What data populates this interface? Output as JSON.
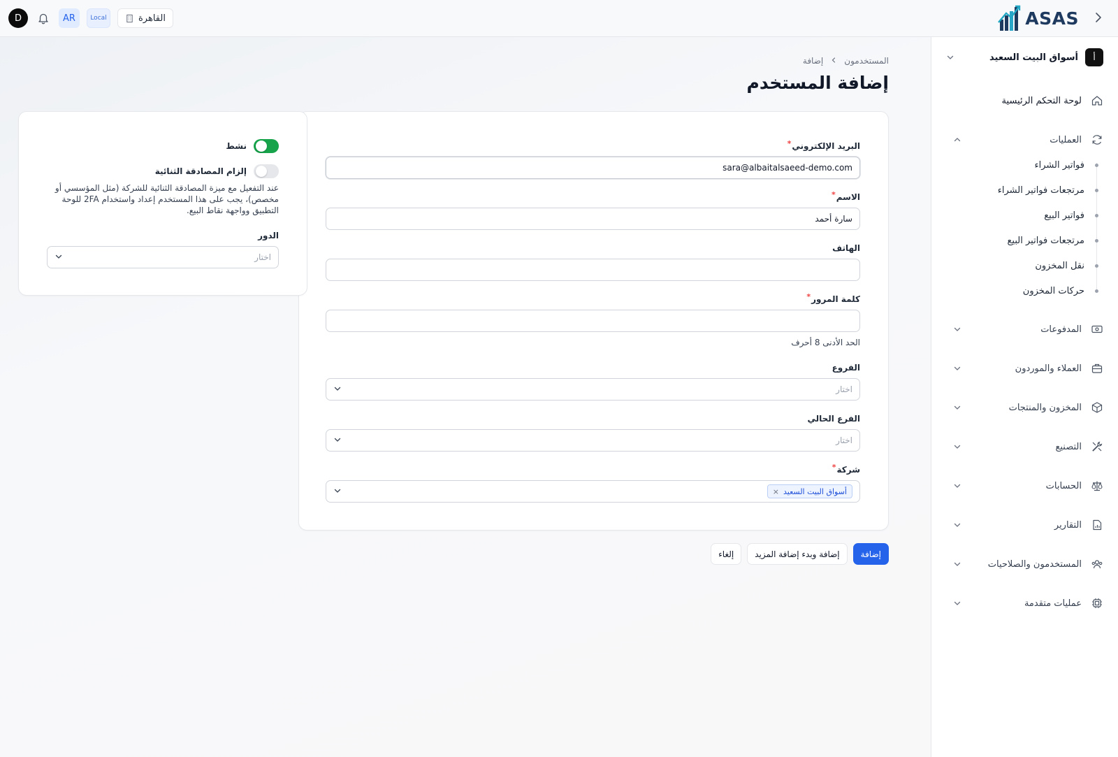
{
  "topbar": {
    "logo_text": "ASAS",
    "avatar_letter": "D",
    "language": "AR",
    "env_badge": "Local",
    "branch": "القاهرة"
  },
  "sidebar": {
    "company_badge": "أ",
    "company_name": "أسواق البيت السعيد",
    "dashboard": "لوحة التحكم الرئيسية",
    "operations": {
      "label": "العمليات",
      "children": [
        "فواتير الشراء",
        "مرتجعات فواتير الشراء",
        "فواتير البيع",
        "مرتجعات فواتير البيع",
        "نقل المخزون",
        "حركات المخزون"
      ]
    },
    "sections": [
      "المدفوعات",
      "العملاء والموردون",
      "المخزون والمنتجات",
      "التصنيع",
      "الحسابات",
      "التقارير",
      "المستخدمون والصلاحيات",
      "عمليات متقدمة"
    ]
  },
  "breadcrumb": {
    "parent": "المستخدمون",
    "current": "إضافة"
  },
  "page": {
    "title": "إضافة المستخدم"
  },
  "form": {
    "email": {
      "label": "البريد الإلكتروني",
      "required": "*",
      "value": "sara@albaitalsaeed-demo.com"
    },
    "name": {
      "label": "الاسم",
      "required": "*",
      "value": "سارة أحمد"
    },
    "phone": {
      "label": "الهاتف",
      "value": ""
    },
    "password": {
      "label": "كلمة المرور",
      "required": "*",
      "value": "",
      "hint": "الحد الأدنى 8 أحرف"
    },
    "branches": {
      "label": "الفروع",
      "placeholder": "اختار"
    },
    "current_branch": {
      "label": "الفرع الحالي",
      "placeholder": "اختار"
    },
    "company": {
      "label": "شركة",
      "required": "*",
      "tag": "أسواق البيت السعيد",
      "tag_remove": "×"
    }
  },
  "side": {
    "active": {
      "label": "نشط",
      "on": true
    },
    "twofa": {
      "label": "إلزام المصادقة الثنائية",
      "on": false,
      "description": "عند التفعيل مع ميزة المصادقة الثنائية للشركة (مثل المؤسسي أو مخصص)، يجب على هذا المستخدم إعداد واستخدام 2FA للوحة التطبيق وواجهة نقاط البيع."
    },
    "role": {
      "label": "الدور",
      "placeholder": "اختار"
    }
  },
  "actions": {
    "add": "إضافة",
    "add_more": "إضافة وبدء إضافة المزيد",
    "cancel": "إلغاء"
  },
  "colors": {
    "primary": "#2563eb",
    "toggle_on": "#16a34a",
    "required": "#ef4444",
    "logo": "#1e3a5f"
  }
}
